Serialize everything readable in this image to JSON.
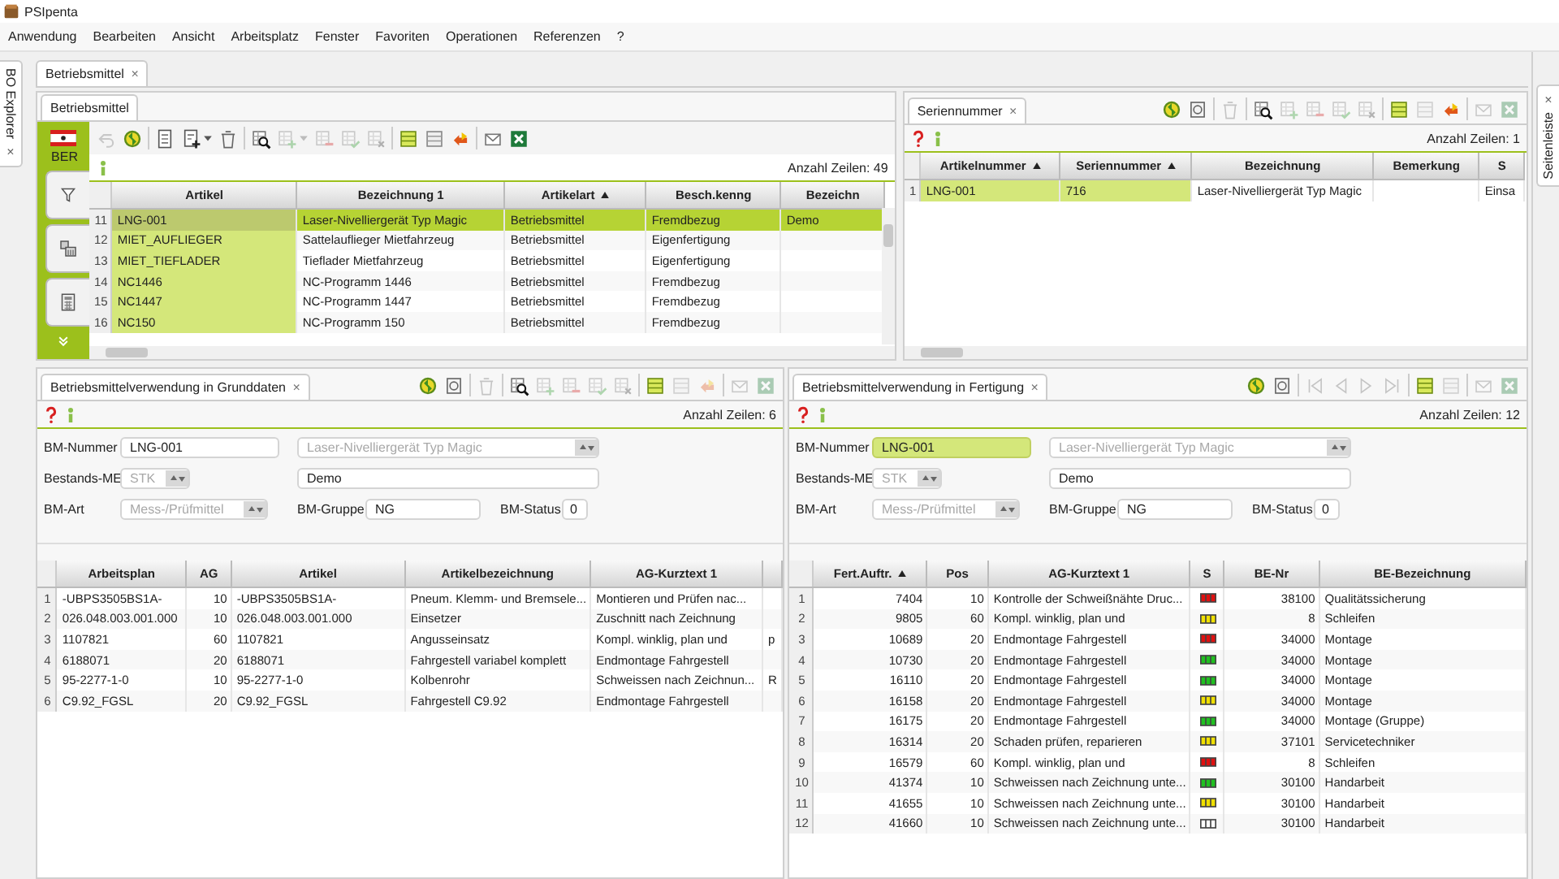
{
  "window": {
    "title": "PSIpenta"
  },
  "menu": [
    "Anwendung",
    "Bearbeiten",
    "Ansicht",
    "Arbeitsplatz",
    "Fenster",
    "Favoriten",
    "Operationen",
    "Referenzen",
    "?"
  ],
  "left_dock": {
    "label": "BO Explorer",
    "close": "×"
  },
  "right_dock": {
    "label": "Seitenleiste",
    "close": "×"
  },
  "editor_tab": {
    "label": "Betriebsmittel",
    "close": "×"
  },
  "articles": {
    "tab": "Betriebsmittel",
    "site": "BER",
    "toolbar": [
      {
        "kind": "undo",
        "disabled": true
      },
      {
        "kind": "refresh",
        "disabled": false
      },
      {
        "kind": "separator"
      },
      {
        "kind": "document",
        "disabled": false
      },
      {
        "kind": "new-doc",
        "disabled": false
      },
      {
        "kind": "caret",
        "disabled": false
      },
      {
        "kind": "trash",
        "disabled": false
      },
      {
        "kind": "separator"
      },
      {
        "kind": "find-grid",
        "disabled": false
      },
      {
        "kind": "grid-add",
        "disabled": true
      },
      {
        "kind": "caret",
        "disabled": true
      },
      {
        "kind": "grid-remove",
        "disabled": true
      },
      {
        "kind": "grid-check",
        "disabled": true
      },
      {
        "kind": "grid-delete",
        "disabled": true
      },
      {
        "kind": "separator"
      },
      {
        "kind": "layout-green",
        "disabled": false
      },
      {
        "kind": "layout-grey",
        "disabled": false
      },
      {
        "kind": "swap",
        "disabled": false
      },
      {
        "kind": "separator"
      },
      {
        "kind": "mail",
        "disabled": false
      },
      {
        "kind": "excel",
        "disabled": false
      }
    ],
    "row_count": "Anzahl Zeilen: 49",
    "table": {
      "columns": [
        {
          "label": "Artikel",
          "key": true
        },
        {
          "label": "Bezeichnung 1"
        },
        {
          "label": "Artikelart",
          "sorted": true
        },
        {
          "label": "Besch.kenng"
        },
        {
          "label": "Bezeichn"
        }
      ],
      "rows": [
        {
          "num": "11",
          "selected": true,
          "cells": [
            "LNG-001",
            "Laser-Nivelliergerät Typ Magic",
            "Betriebsmittel",
            "Fremdbezug",
            "Demo"
          ]
        },
        {
          "num": "12",
          "selected": false,
          "cells": [
            "MIET_AUFLIEGER",
            "Sattelauflieger Mietfahrzeug",
            "Betriebsmittel",
            "Eigenfertigung"
          ]
        },
        {
          "num": "13",
          "selected": false,
          "cells": [
            "MIET_TIEFLADER",
            "Tieflader Mietfahrzeug",
            "Betriebsmittel",
            "Eigenfertigung"
          ]
        },
        {
          "num": "14",
          "selected": false,
          "cells": [
            "NC1446",
            "NC-Programm 1446",
            "Betriebsmittel",
            "Fremdbezug"
          ]
        },
        {
          "num": "15",
          "selected": false,
          "cells": [
            "NC1447",
            "NC-Programm 1447",
            "Betriebsmittel",
            "Fremdbezug"
          ]
        },
        {
          "num": "16",
          "selected": false,
          "cells": [
            "NC150",
            "NC-Programm 150",
            "Betriebsmittel",
            "Fremdbezug"
          ]
        }
      ]
    }
  },
  "serials": {
    "tab": "Seriennummer",
    "close": "×",
    "toolbar": [
      {
        "kind": "refresh",
        "disabled": false
      },
      {
        "kind": "archive",
        "disabled": false
      },
      {
        "kind": "separator"
      },
      {
        "kind": "trash",
        "disabled": true
      },
      {
        "kind": "separator"
      },
      {
        "kind": "find-grid",
        "disabled": false
      },
      {
        "kind": "grid-add",
        "disabled": true
      },
      {
        "kind": "grid-remove",
        "disabled": true
      },
      {
        "kind": "grid-check",
        "disabled": true
      },
      {
        "kind": "grid-delete",
        "disabled": true
      },
      {
        "kind": "separator"
      },
      {
        "kind": "layout-green",
        "disabled": false
      },
      {
        "kind": "layout-grey",
        "disabled": true
      },
      {
        "kind": "swap",
        "disabled": false
      },
      {
        "kind": "separator"
      },
      {
        "kind": "mail",
        "disabled": true
      },
      {
        "kind": "excel",
        "disabled": true
      }
    ],
    "row_count": "Anzahl Zeilen: 1",
    "table": {
      "columns": [
        {
          "label": "Artikelnummer",
          "key": true,
          "sorted": true
        },
        {
          "label": "Seriennummer",
          "key": true,
          "sorted": true
        },
        {
          "label": "Bezeichnung"
        },
        {
          "label": "Bemerkung"
        },
        {
          "label": "S"
        }
      ],
      "rows": [
        {
          "num": "1",
          "selected": false,
          "cells": [
            "LNG-001",
            "716",
            "Laser-Nivelliergerät Typ Magic",
            "",
            "Einsa"
          ]
        }
      ]
    }
  },
  "usage_panels": [
    {
      "tab": "Betriebsmittelverwendung in Grunddaten",
      "close": "×",
      "toolbar": [
        {
          "kind": "refresh",
          "disabled": false
        },
        {
          "kind": "archive",
          "disabled": false
        },
        {
          "kind": "separator"
        },
        {
          "kind": "trash",
          "disabled": true
        },
        {
          "kind": "separator"
        },
        {
          "kind": "find-grid",
          "disabled": false
        },
        {
          "kind": "grid-add",
          "disabled": true
        },
        {
          "kind": "grid-remove",
          "disabled": true
        },
        {
          "kind": "grid-check",
          "disabled": true
        },
        {
          "kind": "grid-delete",
          "disabled": true
        },
        {
          "kind": "separator"
        },
        {
          "kind": "layout-green",
          "disabled": false
        },
        {
          "kind": "layout-grey",
          "disabled": true
        },
        {
          "kind": "swap",
          "disabled": true
        },
        {
          "kind": "separator"
        },
        {
          "kind": "mail",
          "disabled": true
        },
        {
          "kind": "excel",
          "disabled": true
        }
      ],
      "row_count": "Anzahl Zeilen: 6",
      "form": {
        "number": {
          "label": "BM-Nummer",
          "value": "LNG-001",
          "highlighted": false
        },
        "description": {
          "value": "Laser-Nivelliergerät Typ Magic",
          "disabled": true
        },
        "unit": {
          "label": "Bestands-ME",
          "value": "STK",
          "disabled": true
        },
        "note": {
          "value": "Demo"
        },
        "type": {
          "label": "BM-Art",
          "value": "Mess-/Prüfmittel",
          "disabled": true
        },
        "group": {
          "label": "BM-Gruppe",
          "value": "NG"
        },
        "status": {
          "label": "BM-Status",
          "value": "0"
        }
      },
      "table": {
        "columns": [
          {
            "label": "Arbeitsplan"
          },
          {
            "label": "AG"
          },
          {
            "label": "Artikel"
          },
          {
            "label": "Artikelbezeichnung"
          },
          {
            "label": "AG-Kurztext 1"
          },
          {}
        ],
        "rows": [
          {
            "num": "1",
            "selected": false,
            "cells": [
              "-UBPS3505BS1A-",
              "10",
              "-UBPS3505BS1A-",
              "Pneum. Klemm- und Bremsele...",
              "Montieren und Prüfen nac..."
            ]
          },
          {
            "num": "2",
            "selected": false,
            "cells": [
              "026.048.003.001.000",
              "10",
              "026.048.003.001.000",
              "Einsetzer",
              "Zuschnitt nach Zeichnung"
            ]
          },
          {
            "num": "3",
            "selected": false,
            "cells": [
              "1107821",
              "60",
              "1107821",
              "Angusseinsatz",
              "Kompl. winklig, plan und",
              "p"
            ]
          },
          {
            "num": "4",
            "selected": false,
            "cells": [
              "6188071",
              "20",
              "6188071",
              "Fahrgestell variabel komplett",
              "Endmontage Fahrgestell"
            ]
          },
          {
            "num": "5",
            "selected": false,
            "cells": [
              "95-2277-1-0",
              "10",
              "95-2277-1-0",
              "Kolbenrohr",
              "Schweissen nach Zeichnun...",
              "R"
            ]
          },
          {
            "num": "6",
            "selected": false,
            "cells": [
              "C9.92_FGSL",
              "20",
              "C9.92_FGSL",
              "Fahrgestell C9.92",
              "Endmontage Fahrgestell"
            ]
          }
        ]
      }
    },
    {
      "tab": "Betriebsmittelverwendung in Fertigung",
      "close": "×",
      "toolbar": [
        {
          "kind": "refresh",
          "disabled": false
        },
        {
          "kind": "archive",
          "disabled": false
        },
        {
          "kind": "separator"
        },
        {
          "kind": "first",
          "disabled": true
        },
        {
          "kind": "prev",
          "disabled": true
        },
        {
          "kind": "next",
          "disabled": true
        },
        {
          "kind": "last",
          "disabled": true
        },
        {
          "kind": "separator"
        },
        {
          "kind": "layout-green",
          "disabled": false
        },
        {
          "kind": "layout-grey",
          "disabled": true
        },
        {
          "kind": "separator"
        },
        {
          "kind": "mail",
          "disabled": true
        },
        {
          "kind": "excel",
          "disabled": true
        }
      ],
      "row_count": "Anzahl Zeilen: 12",
      "form": {
        "number": {
          "label": "BM-Nummer",
          "value": "LNG-001",
          "highlighted": true
        },
        "description": {
          "value": "Laser-Nivelliergerät Typ Magic",
          "disabled": true
        },
        "unit": {
          "label": "Bestands-ME",
          "value": "STK",
          "disabled": true
        },
        "note": {
          "value": "Demo"
        },
        "type": {
          "label": "BM-Art",
          "value": "Mess-/Prüfmittel",
          "disabled": true
        },
        "group": {
          "label": "BM-Gruppe",
          "value": "NG"
        },
        "status": {
          "label": "BM-Status",
          "value": "0"
        }
      },
      "table": {
        "columns": [
          {
            "label": "Fert.Auftr.",
            "sorted": true
          },
          {
            "label": "Pos"
          },
          {
            "label": "AG-Kurztext 1"
          },
          {
            "label": "S",
            "kind": "status"
          },
          {
            "label": "BE-Nr"
          },
          {
            "label": "BE-Bezeichnung"
          }
        ],
        "rows": [
          {
            "num": "1",
            "selected": false,
            "color": "#e01010",
            "cells": [
              "7404",
              "10",
              "Kontrolle der Schweißnähte Druc...",
              "",
              "38100",
              "Qualitätssicherung"
            ]
          },
          {
            "num": "2",
            "selected": false,
            "color": "#f0e000",
            "cells": [
              "9805",
              "60",
              "Kompl. winklig, plan und",
              "",
              "8",
              "Schleifen"
            ]
          },
          {
            "num": "3",
            "selected": false,
            "color": "#e01010",
            "cells": [
              "10689",
              "20",
              "Endmontage Fahrgestell",
              "",
              "34000",
              "Montage"
            ]
          },
          {
            "num": "4",
            "selected": false,
            "color": "#20c020",
            "cells": [
              "10730",
              "20",
              "Endmontage Fahrgestell",
              "",
              "34000",
              "Montage"
            ]
          },
          {
            "num": "5",
            "selected": false,
            "color": "#20c020",
            "cells": [
              "16110",
              "20",
              "Endmontage Fahrgestell",
              "",
              "34000",
              "Montage"
            ]
          },
          {
            "num": "6",
            "selected": false,
            "color": "#f0e000",
            "cells": [
              "16158",
              "20",
              "Endmontage Fahrgestell",
              "",
              "34000",
              "Montage"
            ]
          },
          {
            "num": "7",
            "selected": false,
            "color": "#20c020",
            "cells": [
              "16175",
              "20",
              "Endmontage Fahrgestell",
              "",
              "34000",
              "Montage (Gruppe)"
            ]
          },
          {
            "num": "8",
            "selected": false,
            "color": "#f0e000",
            "cells": [
              "16314",
              "20",
              "Schaden prüfen, reparieren",
              "",
              "37101",
              "Servicetechniker"
            ]
          },
          {
            "num": "9",
            "selected": false,
            "color": "#e01010",
            "cells": [
              "16579",
              "60",
              "Kompl. winklig, plan und",
              "",
              "8",
              "Schleifen"
            ]
          },
          {
            "num": "10",
            "selected": false,
            "color": "#20c020",
            "cells": [
              "41374",
              "10",
              "Schweissen nach Zeichnung unte...",
              "",
              "30100",
              "Handarbeit"
            ]
          },
          {
            "num": "11",
            "selected": false,
            "color": "#f0e000",
            "cells": [
              "41655",
              "10",
              "Schweissen nach Zeichnung unte...",
              "",
              "30100",
              "Handarbeit"
            ]
          },
          {
            "num": "12",
            "selected": false,
            "color": "#ffffff",
            "cells": [
              "41660",
              "10",
              "Schweissen nach Zeichnung unte...",
              "",
              "30100",
              "Handarbeit"
            ]
          }
        ]
      }
    }
  ]
}
